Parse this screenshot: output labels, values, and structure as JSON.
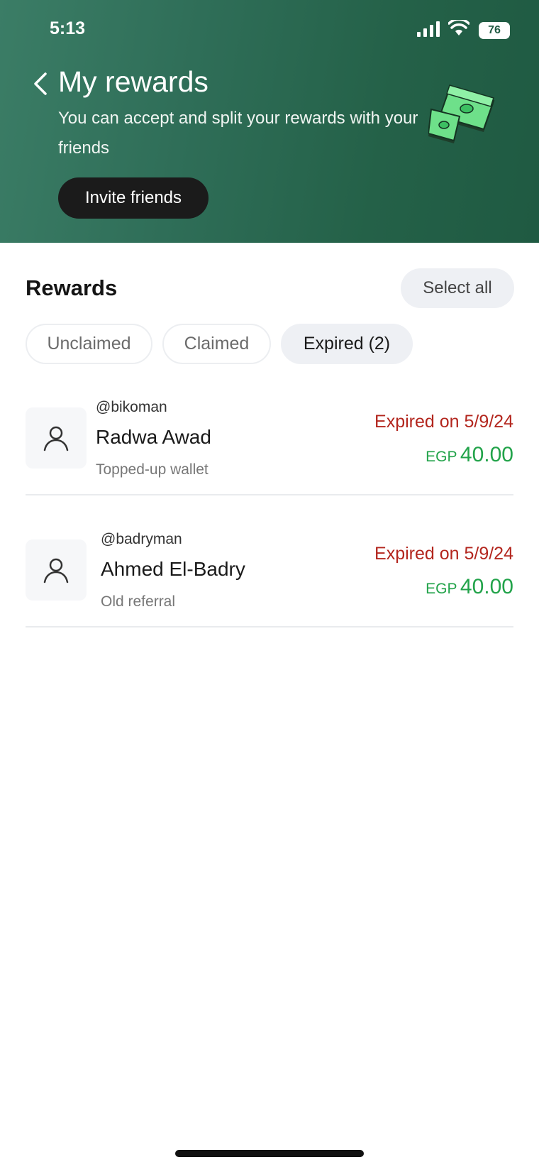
{
  "status_bar": {
    "time": "5:13",
    "battery": "76"
  },
  "header": {
    "title": "My rewards",
    "subtitle": "You can accept and split your rewards with your friends",
    "invite_label": "Invite friends"
  },
  "rewards_section": {
    "title": "Rewards",
    "select_all_label": "Select all",
    "tabs": [
      {
        "label": "Unclaimed",
        "active": false
      },
      {
        "label": "Claimed",
        "active": false
      },
      {
        "label": "Expired (2)",
        "active": true
      }
    ],
    "items": [
      {
        "handle": "@bikoman",
        "name": "Radwa Awad",
        "reason": "Topped-up wallet",
        "status": "Expired on 5/9/24",
        "currency": "EGP",
        "amount": "40.00"
      },
      {
        "handle": "@badryman",
        "name": "Ahmed El-Badry",
        "reason": "Old referral",
        "status": "Expired on 5/9/24",
        "currency": "EGP",
        "amount": "40.00"
      }
    ]
  },
  "colors": {
    "header_green": "#2f6e58",
    "expired_red": "#b3261e",
    "amount_green": "#22a34a"
  }
}
